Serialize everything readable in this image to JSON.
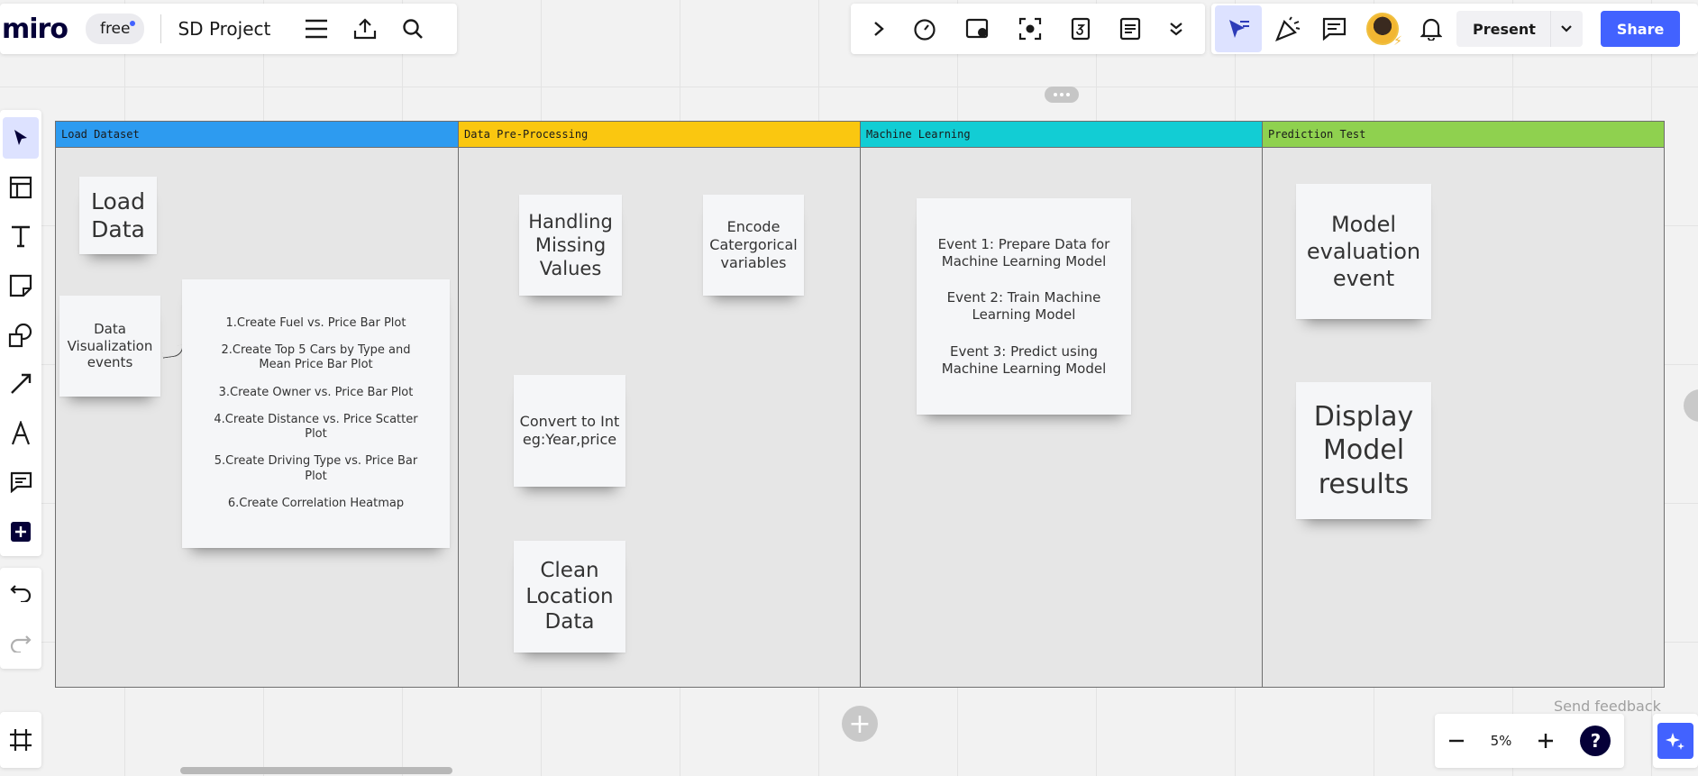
{
  "app": {
    "logo": "miro",
    "plan_badge": "free",
    "board_name": "SD Project"
  },
  "topbar": {
    "present_label": "Present",
    "share_label": "Share"
  },
  "frames": [
    {
      "title": "Load Dataset",
      "color": "#2d9bf0"
    },
    {
      "title": "Data Pre-Processing",
      "color": "#fac710"
    },
    {
      "title": "Machine Learning",
      "color": "#12cdd4"
    },
    {
      "title": "Prediction Test",
      "color": "#8fd14f"
    }
  ],
  "stickies": {
    "load_data": [
      "Load",
      "Data"
    ],
    "data_viz": [
      "Data",
      "Visualization",
      "events"
    ],
    "viz_list": [
      "1.Create Fuel vs. Price Bar Plot",
      "2.Create Top 5 Cars by Type and Mean Price Bar Plot",
      "3.Create Owner vs. Price Bar Plot",
      "4.Create Distance vs. Price Scatter Plot",
      "5.Create Driving Type vs. Price Bar Plot",
      "6.Create Correlation Heatmap"
    ],
    "missing_values": [
      "Handling",
      "Missing",
      "Values"
    ],
    "encode_categorical": [
      "Encode",
      "Catergorical",
      "variables"
    ],
    "convert_int": [
      "Convert to Int",
      "eg:Year,price"
    ],
    "clean_location": [
      "Clean",
      "Location",
      "Data"
    ],
    "ml_events": [
      "Event 1: Prepare Data for Machine Learning Model",
      "Event 2: Train Machine Learning Model",
      "Event 3: Predict using Machine Learning Model"
    ],
    "model_eval": [
      "Model",
      "evaluation",
      "event"
    ],
    "display_results": [
      "Display",
      "Model",
      "results"
    ]
  },
  "bottom": {
    "send_feedback": "Send feedback",
    "zoom": "5%",
    "help": "?"
  },
  "colors": {
    "accent": "#4262ff",
    "sticky_bg": "#f5f6f8"
  }
}
